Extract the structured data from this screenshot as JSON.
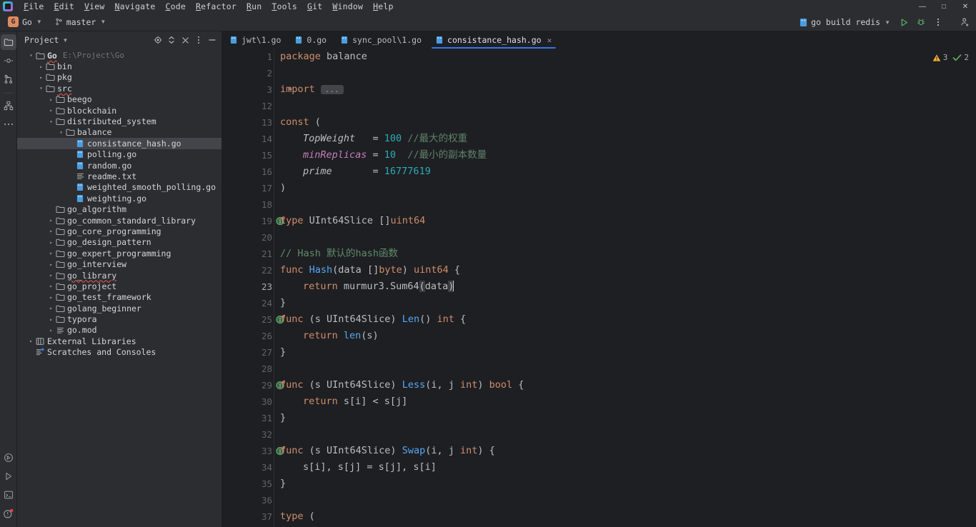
{
  "titlebar": {
    "logo": "goland-logo",
    "menu": [
      "File",
      "Edit",
      "View",
      "Navigate",
      "Code",
      "Refactor",
      "Run",
      "Tools",
      "Git",
      "Window",
      "Help"
    ],
    "window_controls": {
      "minimize": "—",
      "maximize": "□",
      "close": "✕"
    }
  },
  "navbar": {
    "project_badge": "G",
    "project_name": "Go",
    "branch_icon": "branch-icon",
    "branch_name": "master",
    "run_config": "go build redis",
    "run_config_icon": "go-file-icon",
    "run_button": "run-icon",
    "debug_button": "debug-icon",
    "more_button": "more-vertical-icon",
    "account_button": "account-add-icon"
  },
  "rail": {
    "top": [
      "project-icon",
      "commit-icon",
      "pull-requests-icon",
      "structure-icon",
      "more-tool-windows-icon"
    ],
    "bottom": [
      "terminal-icon",
      "run-icon",
      "services-icon",
      "problems-icon"
    ]
  },
  "panel": {
    "title": "Project",
    "title_chevron": "chevron-down-icon",
    "actions": [
      "target-icon",
      "expand-collapse-icon",
      "collapse-all-icon",
      "options-icon",
      "hide-icon"
    ],
    "tree": [
      {
        "depth": 0,
        "arrow": "down",
        "icon": "folder",
        "label": "Go",
        "sub": "E:\\Project\\Go",
        "bold": true,
        "err": true
      },
      {
        "depth": 1,
        "arrow": "right",
        "icon": "folder",
        "label": "bin"
      },
      {
        "depth": 1,
        "arrow": "right",
        "icon": "folder",
        "label": "pkg"
      },
      {
        "depth": 1,
        "arrow": "down",
        "icon": "folder",
        "label": "src",
        "err": true
      },
      {
        "depth": 2,
        "arrow": "right",
        "icon": "folder",
        "label": "beego"
      },
      {
        "depth": 2,
        "arrow": "right",
        "icon": "folder",
        "label": "blockchain"
      },
      {
        "depth": 2,
        "arrow": "down",
        "icon": "folder",
        "label": "distributed_system"
      },
      {
        "depth": 3,
        "arrow": "down",
        "icon": "folder",
        "label": "balance"
      },
      {
        "depth": 4,
        "arrow": "none",
        "icon": "gofile",
        "label": "consistance_hash.go",
        "selected": true
      },
      {
        "depth": 4,
        "arrow": "none",
        "icon": "gofile",
        "label": "polling.go"
      },
      {
        "depth": 4,
        "arrow": "none",
        "icon": "gofile",
        "label": "random.go"
      },
      {
        "depth": 4,
        "arrow": "none",
        "icon": "txtfile",
        "label": "readme.txt"
      },
      {
        "depth": 4,
        "arrow": "none",
        "icon": "gofile",
        "label": "weighted_smooth_polling.go"
      },
      {
        "depth": 4,
        "arrow": "none",
        "icon": "gofile",
        "label": "weighting.go"
      },
      {
        "depth": 2,
        "arrow": "none",
        "icon": "folder",
        "label": "go_algorithm"
      },
      {
        "depth": 2,
        "arrow": "right",
        "icon": "folder",
        "label": "go_common_standard_library"
      },
      {
        "depth": 2,
        "arrow": "right",
        "icon": "folder",
        "label": "go_core_programming"
      },
      {
        "depth": 2,
        "arrow": "right",
        "icon": "folder",
        "label": "go_design_pattern"
      },
      {
        "depth": 2,
        "arrow": "right",
        "icon": "folder",
        "label": "go_expert_programming"
      },
      {
        "depth": 2,
        "arrow": "right",
        "icon": "folder",
        "label": "go_interview"
      },
      {
        "depth": 2,
        "arrow": "right",
        "icon": "folder",
        "label": "go_library",
        "err": true
      },
      {
        "depth": 2,
        "arrow": "right",
        "icon": "folder",
        "label": "go_project"
      },
      {
        "depth": 2,
        "arrow": "right",
        "icon": "folder",
        "label": "go_test_framework"
      },
      {
        "depth": 2,
        "arrow": "right",
        "icon": "folder",
        "label": "golang_beginner"
      },
      {
        "depth": 2,
        "arrow": "right",
        "icon": "folder",
        "label": "typora"
      },
      {
        "depth": 2,
        "arrow": "right",
        "icon": "modfile",
        "label": "go.mod"
      },
      {
        "depth": 0,
        "arrow": "right",
        "icon": "library",
        "label": "External Libraries"
      },
      {
        "depth": 0,
        "arrow": "none",
        "icon": "scratch",
        "label": "Scratches and Consoles"
      }
    ]
  },
  "editor": {
    "tabs": [
      {
        "label": "jwt\\1.go",
        "icon": "go-file-icon",
        "active": false,
        "closable": false
      },
      {
        "label": "0.go",
        "icon": "go-file-icon",
        "active": false,
        "closable": false
      },
      {
        "label": "sync_pool\\1.go",
        "icon": "go-file-icon",
        "active": false,
        "closable": false
      },
      {
        "label": "consistance_hash.go",
        "icon": "go-file-icon",
        "active": true,
        "closable": true,
        "close": "✕"
      }
    ],
    "inspections": {
      "warning_icon": "warning-triangle-icon",
      "warning_count": "3",
      "ok_icon": "checkmark-icon",
      "ok_count": "2"
    },
    "fold_placeholder": "...",
    "caret_line": 23,
    "lines": [
      {
        "n": "1",
        "gutter": "",
        "indent": 0,
        "tokens": [
          {
            "t": "package ",
            "c": "kw"
          },
          {
            "t": "balance",
            "c": "ident"
          }
        ]
      },
      {
        "n": "2",
        "gutter": "",
        "indent": 0,
        "tokens": []
      },
      {
        "n": "3",
        "gutter": "",
        "fold": true,
        "indent": 0,
        "tokens": [
          {
            "t": "import ",
            "c": "kw"
          },
          {
            "t": "...",
            "c": "foldph"
          }
        ]
      },
      {
        "n": "12",
        "gutter": "",
        "indent": 0,
        "tokens": []
      },
      {
        "n": "13",
        "gutter": "",
        "indent": 0,
        "tokens": [
          {
            "t": "const",
            "c": "kw"
          },
          {
            "t": " (",
            "c": "brk"
          }
        ]
      },
      {
        "n": "14",
        "gutter": "",
        "indent": 1,
        "tokens": [
          {
            "t": "TopWeight",
            "c": "cnst2"
          },
          {
            "t": "   = ",
            "c": "brk"
          },
          {
            "t": "100",
            "c": "num"
          },
          {
            "t": " ",
            "c": "brk"
          },
          {
            "t": "//最大的权重",
            "c": "cmt"
          }
        ]
      },
      {
        "n": "15",
        "gutter": "",
        "indent": 1,
        "tokens": [
          {
            "t": "minReplicas",
            "c": "cnst"
          },
          {
            "t": " = ",
            "c": "brk"
          },
          {
            "t": "10",
            "c": "num"
          },
          {
            "t": "  ",
            "c": "brk"
          },
          {
            "t": "//最小的副本数量",
            "c": "cmt"
          }
        ]
      },
      {
        "n": "16",
        "gutter": "",
        "indent": 1,
        "tokens": [
          {
            "t": "prime",
            "c": "cnst2"
          },
          {
            "t": "       = ",
            "c": "brk"
          },
          {
            "t": "16777619",
            "c": "num"
          }
        ]
      },
      {
        "n": "17",
        "gutter": "",
        "indent": 0,
        "tokens": [
          {
            "t": ")",
            "c": "brk"
          }
        ]
      },
      {
        "n": "18",
        "gutter": "",
        "indent": 0,
        "tokens": []
      },
      {
        "n": "19",
        "gutter": "impl",
        "indent": 0,
        "tokens": [
          {
            "t": "type",
            "c": "kw"
          },
          {
            "t": " UInt64Slice ",
            "c": "ident"
          },
          {
            "t": "[]",
            "c": "brk"
          },
          {
            "t": "uint64",
            "c": "typ"
          }
        ]
      },
      {
        "n": "20",
        "gutter": "",
        "indent": 0,
        "tokens": []
      },
      {
        "n": "21",
        "gutter": "",
        "indent": 0,
        "tokens": [
          {
            "t": "// Hash 默认的hash函数",
            "c": "cmt2"
          }
        ]
      },
      {
        "n": "22",
        "gutter": "",
        "indent": 0,
        "tokens": [
          {
            "t": "func ",
            "c": "kw"
          },
          {
            "t": "Hash",
            "c": "fn"
          },
          {
            "t": "(data ",
            "c": "brk"
          },
          {
            "t": "[]",
            "c": "brk"
          },
          {
            "t": "byte",
            "c": "typ"
          },
          {
            "t": ") ",
            "c": "brk"
          },
          {
            "t": "uint64",
            "c": "typ"
          },
          {
            "t": " {",
            "c": "brk"
          }
        ]
      },
      {
        "n": "23",
        "gutter": "",
        "indent": 1,
        "highlight": true,
        "tokens": [
          {
            "t": "return ",
            "c": "kw"
          },
          {
            "t": "murmur3",
            "c": "mem"
          },
          {
            "t": ".",
            "c": "brk"
          },
          {
            "t": "Sum64",
            "c": "mem"
          },
          {
            "t": "(",
            "c": "sel"
          },
          {
            "t": "data",
            "c": "brk"
          },
          {
            "t": ")",
            "c": "sel"
          }
        ]
      },
      {
        "n": "24",
        "gutter": "",
        "indent": 0,
        "tokens": [
          {
            "t": "}",
            "c": "brk"
          }
        ]
      },
      {
        "n": "25",
        "gutter": "impl",
        "indent": 0,
        "tokens": [
          {
            "t": "func ",
            "c": "kw"
          },
          {
            "t": "(s UInt64Slice) ",
            "c": "brk"
          },
          {
            "t": "Len",
            "c": "fn"
          },
          {
            "t": "() ",
            "c": "brk"
          },
          {
            "t": "int",
            "c": "typ"
          },
          {
            "t": " {",
            "c": "brk"
          }
        ]
      },
      {
        "n": "26",
        "gutter": "",
        "indent": 1,
        "tokens": [
          {
            "t": "return ",
            "c": "kw"
          },
          {
            "t": "len",
            "c": "fn"
          },
          {
            "t": "(s)",
            "c": "brk"
          }
        ]
      },
      {
        "n": "27",
        "gutter": "",
        "indent": 0,
        "tokens": [
          {
            "t": "}",
            "c": "brk"
          }
        ]
      },
      {
        "n": "28",
        "gutter": "",
        "indent": 0,
        "tokens": []
      },
      {
        "n": "29",
        "gutter": "impl",
        "indent": 0,
        "tokens": [
          {
            "t": "func ",
            "c": "kw"
          },
          {
            "t": "(s UInt64Slice) ",
            "c": "brk"
          },
          {
            "t": "Less",
            "c": "fn"
          },
          {
            "t": "(i, j ",
            "c": "brk"
          },
          {
            "t": "int",
            "c": "typ"
          },
          {
            "t": ") ",
            "c": "brk"
          },
          {
            "t": "bool",
            "c": "typ"
          },
          {
            "t": " {",
            "c": "brk"
          }
        ]
      },
      {
        "n": "30",
        "gutter": "",
        "indent": 1,
        "tokens": [
          {
            "t": "return ",
            "c": "kw"
          },
          {
            "t": "s[i] < s[j]",
            "c": "brk"
          }
        ]
      },
      {
        "n": "31",
        "gutter": "",
        "indent": 0,
        "tokens": [
          {
            "t": "}",
            "c": "brk"
          }
        ]
      },
      {
        "n": "32",
        "gutter": "",
        "indent": 0,
        "tokens": []
      },
      {
        "n": "33",
        "gutter": "impl",
        "indent": 0,
        "tokens": [
          {
            "t": "func ",
            "c": "kw"
          },
          {
            "t": "(s UInt64Slice) ",
            "c": "brk"
          },
          {
            "t": "Swap",
            "c": "fn"
          },
          {
            "t": "(i, j ",
            "c": "brk"
          },
          {
            "t": "int",
            "c": "typ"
          },
          {
            "t": ") {",
            "c": "brk"
          }
        ]
      },
      {
        "n": "34",
        "gutter": "",
        "indent": 1,
        "tokens": [
          {
            "t": "s[i], s[j] = s[j], s[i]",
            "c": "brk"
          }
        ]
      },
      {
        "n": "35",
        "gutter": "",
        "indent": 0,
        "tokens": [
          {
            "t": "}",
            "c": "brk"
          }
        ]
      },
      {
        "n": "36",
        "gutter": "",
        "indent": 0,
        "tokens": []
      },
      {
        "n": "37",
        "gutter": "",
        "indent": 0,
        "tokens": [
          {
            "t": "type",
            "c": "kw"
          },
          {
            "t": " (",
            "c": "brk"
          }
        ]
      }
    ]
  }
}
